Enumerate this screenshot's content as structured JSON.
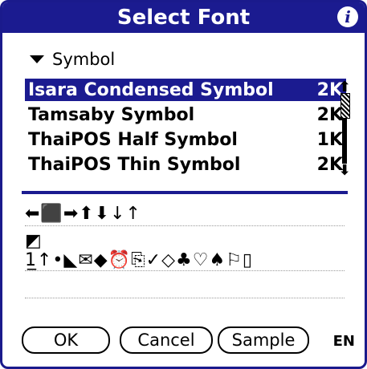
{
  "title": "Select Font",
  "category": {
    "label": "Symbol"
  },
  "fonts": [
    {
      "name": "Isara Condensed Symbol",
      "size": "2K"
    },
    {
      "name": "Tamsaby Symbol",
      "size": "2K"
    },
    {
      "name": "ThaiPOS Half Symbol",
      "size": "1K"
    },
    {
      "name": "ThaiPOS Thin Symbol",
      "size": "2K"
    }
  ],
  "selected_font_index": 0,
  "sample": {
    "line1": "⬅⬛➡⬆⬇↓↑",
    "line2": "◩",
    "line3": "1̲↑•◣✉◆⏰⎘✓◇♣♡♠⚐▯"
  },
  "buttons": {
    "ok": "OK",
    "cancel": "Cancel",
    "sample": "Sample"
  },
  "input_mode": "EN",
  "icons": {
    "info": "info-icon",
    "category_toggle": "triangle-down-icon",
    "scroll_up": "arrow-up-icon",
    "scroll_down": "arrow-down-icon"
  },
  "colors": {
    "titlebar": "#1b1b90",
    "selection": "#1b1b90",
    "divider": "#1b1b90"
  }
}
